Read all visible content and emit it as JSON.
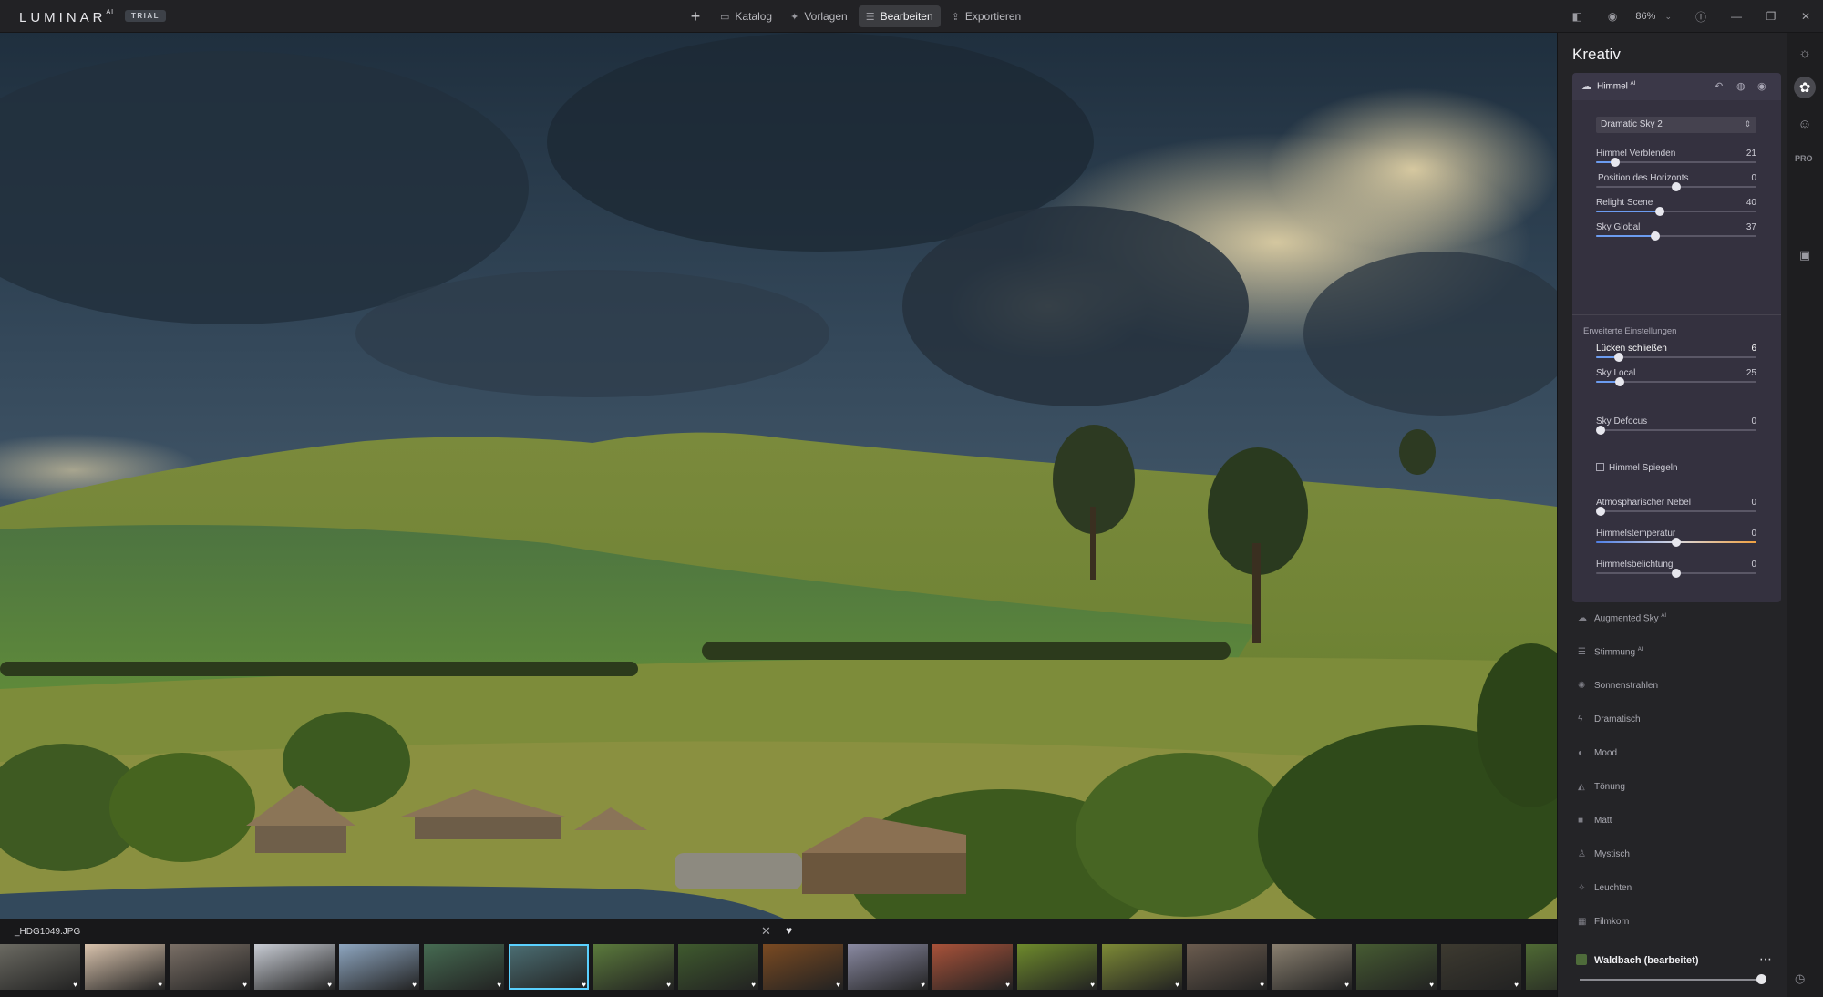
{
  "app": {
    "logo": "LUMINAR",
    "logo_suffix": "AI",
    "trial_badge": "TRIAL"
  },
  "nav": {
    "add_icon": "plus-icon",
    "items": [
      {
        "label": "Katalog",
        "icon": "folder-icon"
      },
      {
        "label": "Vorlagen",
        "icon": "sparkle-icon"
      },
      {
        "label": "Bearbeiten",
        "icon": "sliders-icon",
        "active": true
      },
      {
        "label": "Exportieren",
        "icon": "export-icon"
      }
    ]
  },
  "topright": {
    "zoom": "86%"
  },
  "filmstrip": {
    "filename": "_HDG1049.JPG",
    "thumb_colors": [
      "#6b6a62",
      "#d9c3ad",
      "#7a6f66",
      "#c8ccd4",
      "#8ea6c0",
      "#466b52",
      "#4c6f74",
      "#5b7a3c",
      "#3f5a2e",
      "#7a4a22",
      "#8a8aa2",
      "#a8523a",
      "#6e8a2c",
      "#7d8a36",
      "#6b5c4f",
      "#8a8070",
      "#465b32",
      "#3d3a30",
      "#4f6a34"
    ],
    "selected_index": 6
  },
  "panel": {
    "title": "Kreativ",
    "himmel": {
      "title": "Himmel",
      "title_suffix": "AI",
      "preset": "Dramatic Sky 2",
      "sliders_main": [
        {
          "label": "Himmel Verblenden",
          "value": "21"
        },
        {
          "label": "Position des Horizonts",
          "value": "0"
        },
        {
          "label": "Relight Scene",
          "value": "40"
        },
        {
          "label": "Sky Global",
          "value": "37"
        }
      ],
      "advanced_label": "Erweiterte Einstellungen",
      "sliders_adv": [
        {
          "label": "Lücken schließen",
          "value": "6"
        },
        {
          "label": "Sky Local",
          "value": "25"
        },
        {
          "label": "Sky Defocus",
          "value": "0"
        }
      ],
      "mirror_label": "Himmel Spiegeln",
      "sliders_atm": [
        {
          "label": "Atmosphärischer Nebel",
          "value": "0"
        },
        {
          "label": "Himmelstemperatur",
          "value": "0"
        },
        {
          "label": "Himmelsbelichtung",
          "value": "0"
        }
      ]
    },
    "tools": [
      {
        "label": "Augmented Sky",
        "suffix": "AI",
        "icon": "cloud-icon"
      },
      {
        "label": "Stimmung",
        "suffix": "AI",
        "icon": "lines-icon"
      },
      {
        "label": "Sonnenstrahlen",
        "icon": "sun-rays-icon"
      },
      {
        "label": "Dramatisch",
        "icon": "bolt-icon"
      },
      {
        "label": "Mood",
        "icon": "circle-icon"
      },
      {
        "label": "Tönung",
        "icon": "tint-icon"
      },
      {
        "label": "Matt",
        "icon": "square-icon"
      },
      {
        "label": "Mystisch",
        "icon": "figure-icon"
      },
      {
        "label": "Leuchten",
        "icon": "glow-icon"
      },
      {
        "label": "Filmkorn",
        "icon": "grain-icon"
      }
    ],
    "preset_footer": {
      "label": "Waldbach (bearbeitet)"
    }
  },
  "rail": {
    "pro_label": "PRO"
  }
}
